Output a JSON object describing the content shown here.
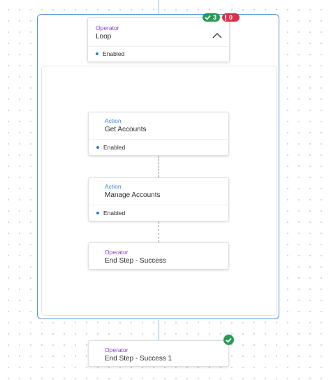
{
  "loop": {
    "kind": "Operator",
    "name": "Loop",
    "status": "Enabled",
    "success_count": "3",
    "error_count": "0"
  },
  "steps": [
    {
      "kind": "Action",
      "name": "Get Accounts",
      "status": "Enabled"
    },
    {
      "kind": "Action",
      "name": "Manage Accounts",
      "status": "Enabled"
    },
    {
      "kind": "Operator",
      "name": "End Step - Success"
    }
  ],
  "final_step": {
    "kind": "Operator",
    "name": "End Step - Success 1"
  },
  "colors": {
    "action": "#3a86d4",
    "operator": "#8b3fc8",
    "success": "#2a9a55",
    "error": "#d8334a",
    "selected_border": "#4a8fd6"
  }
}
